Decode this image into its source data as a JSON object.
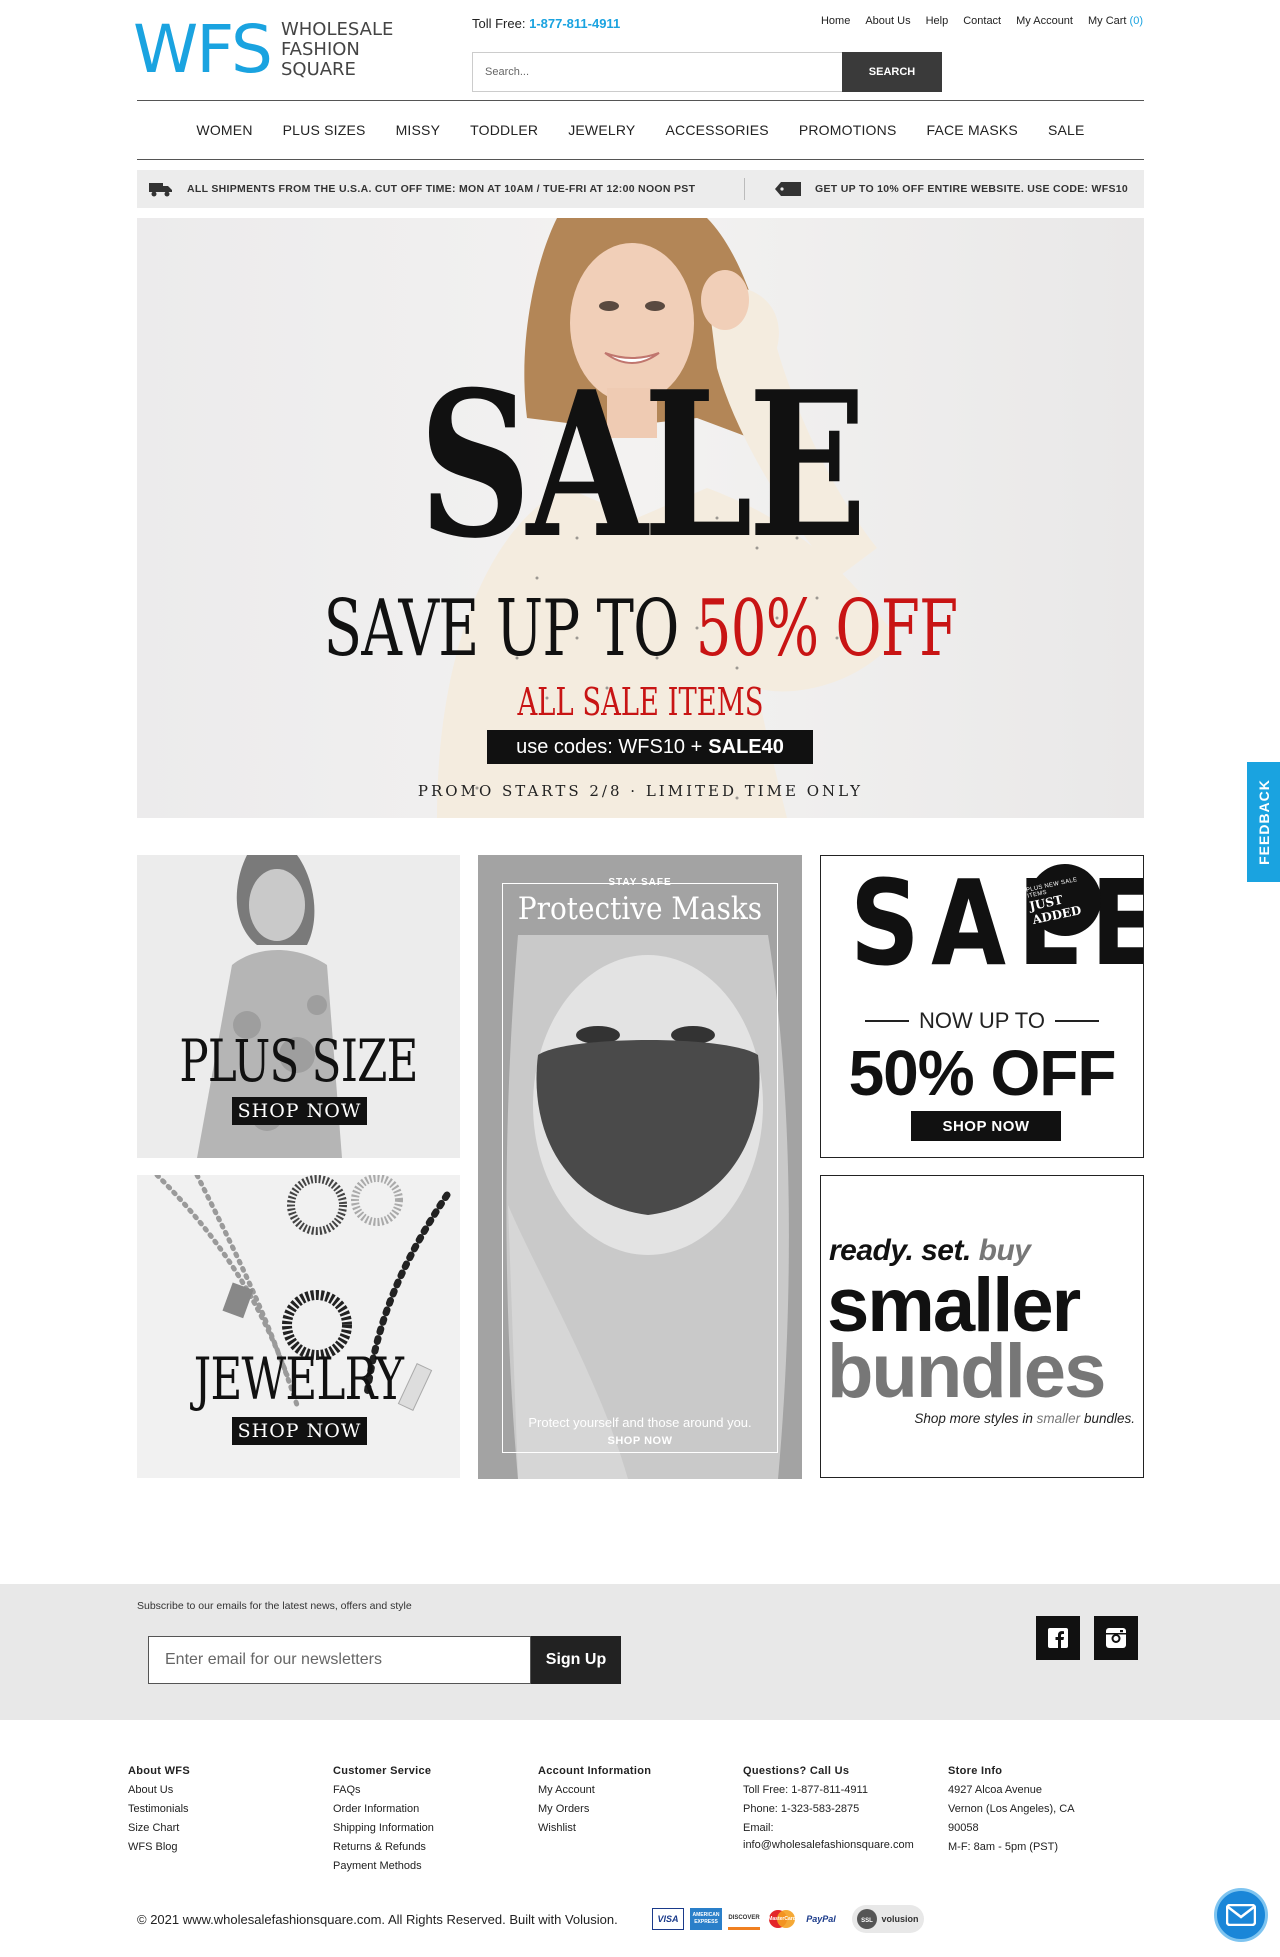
{
  "header": {
    "logo_mark": "WFS",
    "logo_line1": "WHOLESALE",
    "logo_line2": "FASHION",
    "logo_line3": "SQUARE",
    "toll_label": "Toll Free:",
    "toll_number": "1-877-811-4911",
    "links": [
      "Home",
      "About Us",
      "Help",
      "Contact",
      "My Account",
      "My Cart"
    ],
    "cart_count": "(0)",
    "search_placeholder": "Search...",
    "search_button": "SEARCH"
  },
  "nav": [
    "WOMEN",
    "PLUS SIZES",
    "MISSY",
    "TODDLER",
    "JEWELRY",
    "ACCESSORIES",
    "PROMOTIONS",
    "FACE MASKS",
    "SALE"
  ],
  "notice": {
    "shipping": "ALL SHIPMENTS FROM THE U.S.A. CUT OFF TIME: MON AT 10AM / TUE-FRI AT 12:00 NOON PST",
    "discount": "GET UP TO 10% OFF ENTIRE WEBSITE. USE CODE: WFS10"
  },
  "hero": {
    "sale": "SALE",
    "save_prefix": "SAVE UP TO",
    "save_pct": "50% OFF",
    "all_sale": "ALL SALE ITEMS",
    "codes_prefix": "use codes: WFS10 +",
    "codes_bold": "SALE40",
    "promo": "PROMO STARTS 2/8  ·  LIMITED TIME ONLY"
  },
  "tiles": {
    "plus_title": "PLUS SIZE",
    "plus_btn": "SHOP NOW",
    "jewelry_title": "JEWELRY",
    "jewelry_btn": "SHOP NOW",
    "masks_kicker": "STAY SAFE",
    "masks_title": "Protective Masks",
    "masks_tagline": "Protect yourself and those around you.",
    "masks_btn": "SHOP NOW",
    "sale_word": "SALE",
    "sale_badge_small": "PLUS NEW SALE ITEMS",
    "sale_badge": "JUST ADDED",
    "sale_now": "NOW UP TO",
    "sale_pct": "50% OFF",
    "sale_btn": "SHOP NOW",
    "bundles_l1a": "ready. set.",
    "bundles_l1b": "buy",
    "bundles_l2": "smaller",
    "bundles_l3": "bundles",
    "bundles_l4a": "Shop more styles in",
    "bundles_l4b": "smaller",
    "bundles_l4c": "bundles."
  },
  "newsletter": {
    "label": "Subscribe to our emails for the latest news, offers and style",
    "placeholder": "Enter email for our newsletters",
    "button": "Sign Up"
  },
  "footer": {
    "about": {
      "title": "About WFS",
      "items": [
        "About Us",
        "Testimonials",
        "Size Chart",
        "WFS Blog"
      ]
    },
    "service": {
      "title": "Customer Service",
      "items": [
        "FAQs",
        "Order Information",
        "Shipping Information",
        "Returns & Refunds",
        "Payment Methods"
      ]
    },
    "account": {
      "title": "Account Information",
      "items": [
        "My Account",
        "My Orders",
        "Wishlist"
      ]
    },
    "call": {
      "title": "Questions? Call Us",
      "items": [
        "Toll Free: 1-877-811-4911",
        "Phone: 1-323-583-2875",
        "Email:",
        "info@wholesalefashionsquare.com"
      ]
    },
    "store": {
      "title": "Store Info",
      "items": [
        "4927 Alcoa Avenue",
        "Vernon (Los Angeles), CA",
        "90058",
        "M-F: 8am - 5pm (PST)"
      ]
    },
    "copyright": "© 2021 www.wholesalefashionsquare.com. All Rights Reserved. Built with Volusion.",
    "payments": [
      "VISA",
      "AMERICAN EXPRESS",
      "DISCOVER",
      "MasterCard",
      "PayPal",
      "volusion"
    ]
  },
  "feedback": "FEEDBACK",
  "colors": {
    "brand": "#1aa3e0",
    "sale_red": "#c81414",
    "dark": "#111111"
  }
}
